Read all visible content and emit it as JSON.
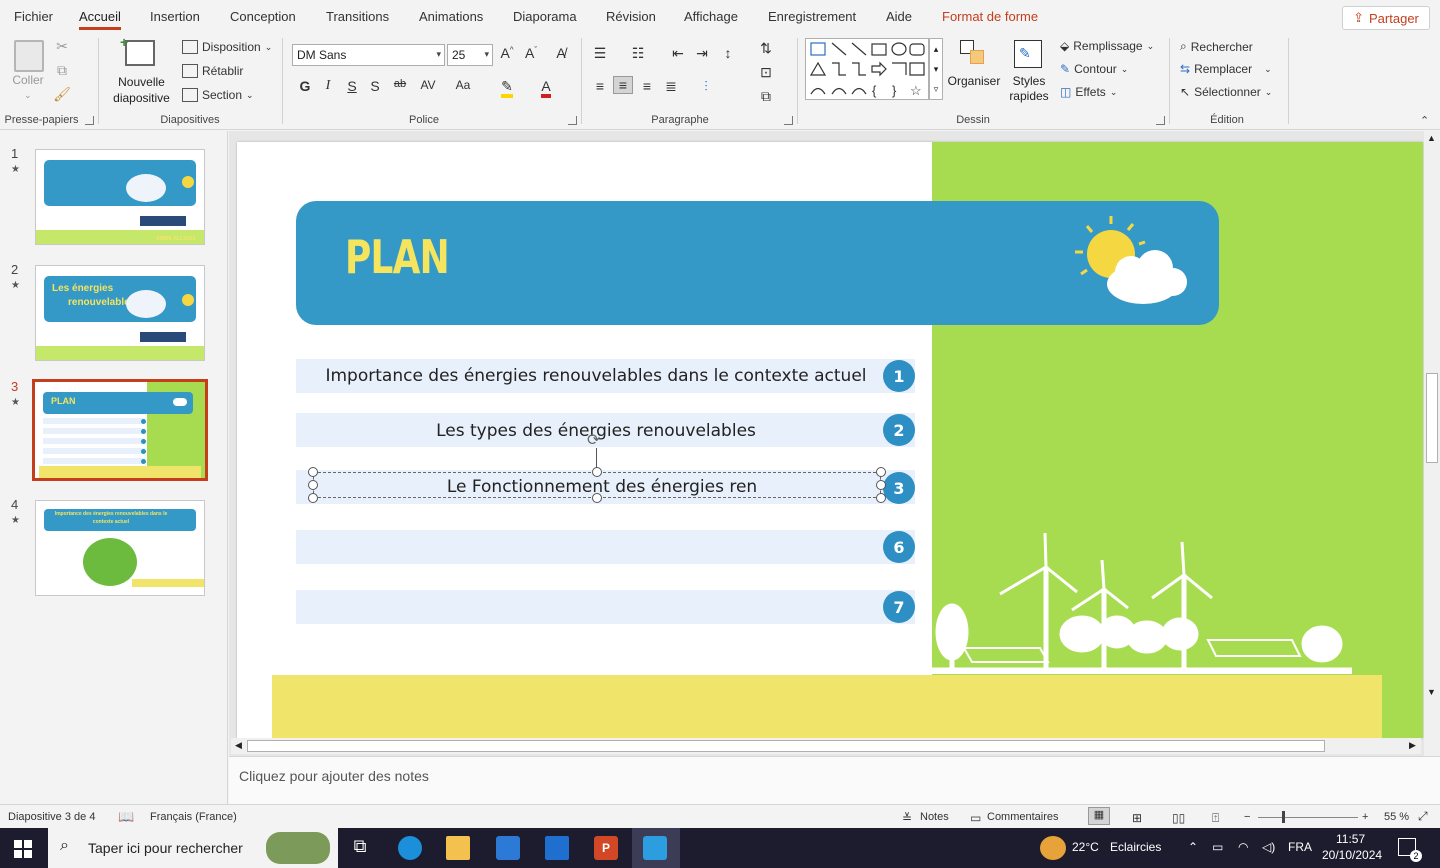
{
  "tabs": {
    "file": "Fichier",
    "home": "Accueil",
    "insert": "Insertion",
    "design": "Conception",
    "transitions": "Transitions",
    "animations": "Animations",
    "slideshow": "Diaporama",
    "review": "Révision",
    "view": "Affichage",
    "record": "Enregistrement",
    "help": "Aide",
    "shape_format": "Format de forme",
    "share": "Partager"
  },
  "ribbon": {
    "clipboard": {
      "paste": "Coller",
      "label": "Presse-papiers"
    },
    "slides": {
      "new_slide_1": "Nouvelle",
      "new_slide_2": "diapositive",
      "layout": "Disposition",
      "reset": "Rétablir",
      "section": "Section",
      "label": "Diapositives"
    },
    "font": {
      "name": "DM Sans",
      "size": "25",
      "label": "Police"
    },
    "paragraph": {
      "label": "Paragraphe"
    },
    "drawing": {
      "arrange": "Organiser",
      "quick_styles_1": "Styles",
      "quick_styles_2": "rapides",
      "fill": "Remplissage",
      "outline": "Contour",
      "effects": "Effets",
      "label": "Dessin"
    },
    "editing": {
      "find": "Rechercher",
      "replace": "Remplacer",
      "select": "Sélectionner",
      "label": "Édition"
    }
  },
  "thumbnails": [
    {
      "num": "1",
      "text": "AMINE ALLAOUI"
    },
    {
      "num": "2",
      "title_1": "Les énergies",
      "title_2": "renouvelables"
    },
    {
      "num": "3",
      "title": "PLAN"
    },
    {
      "num": "4",
      "title_1": "Importance des énergies renouvelables dans le",
      "title_2": "contexte actuel"
    }
  ],
  "slide": {
    "title": "PLAN",
    "items": [
      {
        "text": "Importance des énergies renouvelables dans le contexte actuel",
        "num": "1"
      },
      {
        "text": "Les types des énergies renouvelables",
        "num": "2"
      },
      {
        "text": "Le Fonctionnement des énergies ren",
        "num": "3"
      },
      {
        "text": "",
        "num": "6"
      },
      {
        "text": "",
        "num": "7"
      }
    ]
  },
  "notes": {
    "placeholder": "Cliquez pour ajouter des notes"
  },
  "status": {
    "slide_count": "Diapositive 3 de 4",
    "language": "Français (France)",
    "notes": "Notes",
    "comments": "Commentaires",
    "zoom": "55 %"
  },
  "taskbar": {
    "search_placeholder": "Taper ici pour rechercher",
    "weather_temp": "22°C",
    "weather_text": "Eclaircies",
    "lang": "FRA",
    "time": "11:57",
    "date": "20/10/2024",
    "notif_count": "2"
  },
  "colors": {
    "accent": "#c43e1c",
    "slide_blue": "#3599c8",
    "slide_green": "#a8dc50",
    "slide_yellow": "#f0e56a",
    "title_yellow": "#f4e45e",
    "item_bg": "#e8f0fb",
    "number_circle": "#2e8fc4"
  }
}
